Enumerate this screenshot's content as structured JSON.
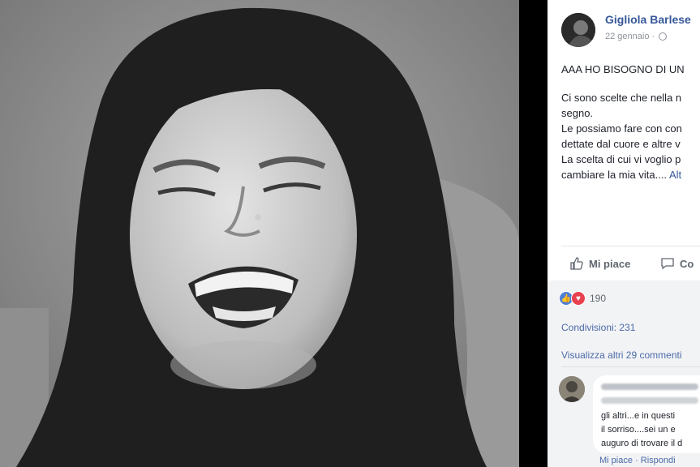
{
  "post": {
    "author": "Gigliola Barlese",
    "date": "22 gennaio · ",
    "lines": [
      "AAA HO BISOGNO DI UN",
      "Ci sono scelte che nella n",
      "segno.",
      "Le possiamo fare con con",
      "dettate dal cuore e altre v",
      "La scelta di cui vi voglio p",
      "cambiare la mia vita.... "
    ],
    "more_link": "Alt"
  },
  "actions": {
    "like_label": "Mi piace",
    "comment_label": "Co"
  },
  "stats": {
    "reaction_count": "190",
    "shares_text": "Condivisioni: 231",
    "view_more_comments": "Visualizza altri 29 commenti"
  },
  "comment": {
    "lines": [
      "gli altri...e in questi",
      "il sorriso....sei un e",
      "auguro di trovare il d"
    ],
    "like_label": "Mi piace",
    "reply_label": "Rispondi"
  },
  "colors": {
    "link_blue": "#365899",
    "like_blue": "#4f7fd8",
    "love_red": "#e8404f"
  }
}
